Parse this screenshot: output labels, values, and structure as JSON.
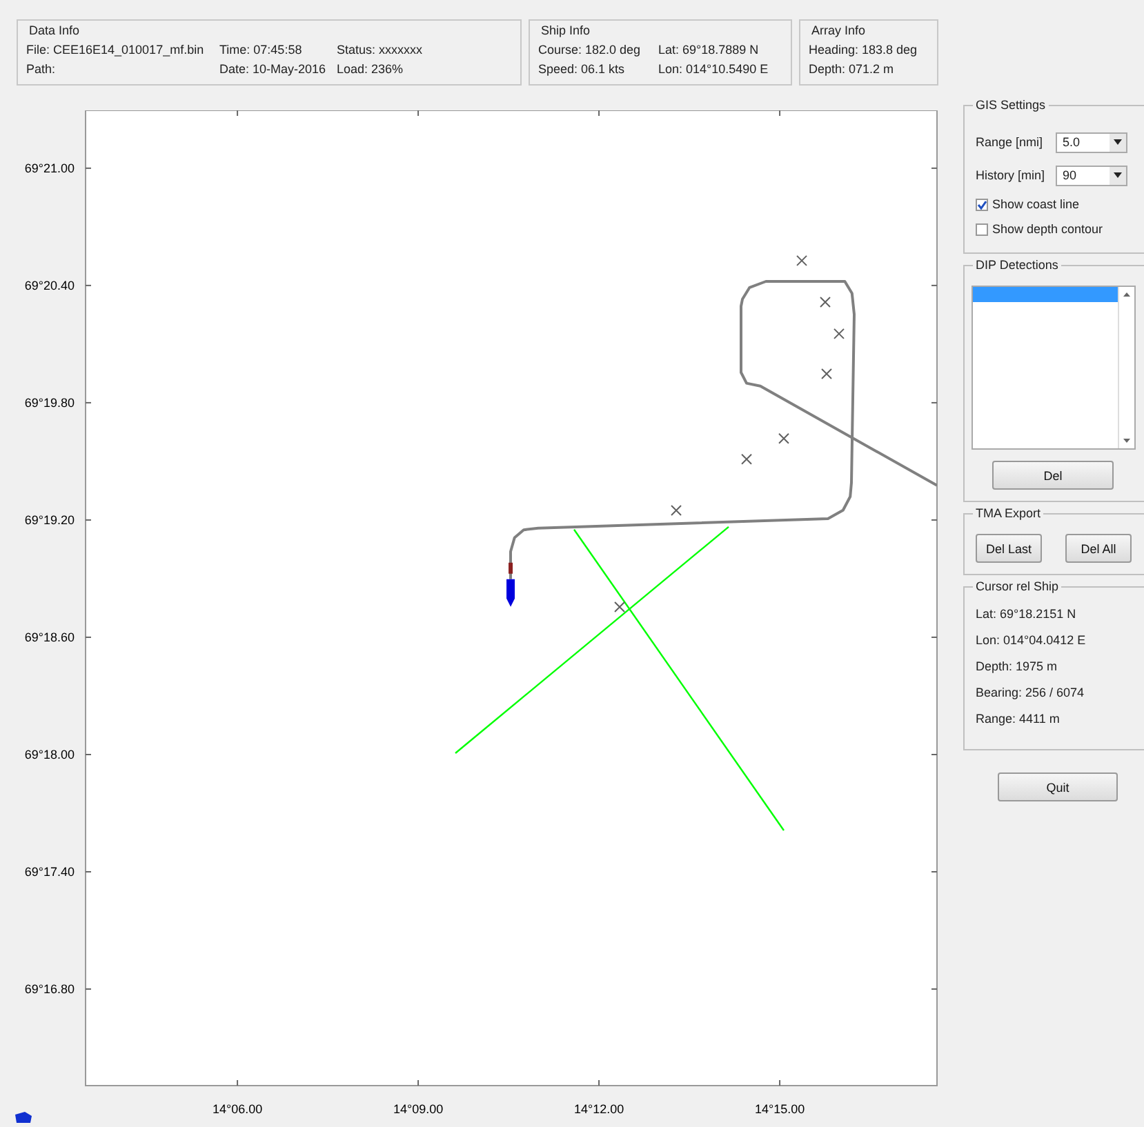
{
  "header": [
    {
      "title": "Data Info",
      "rows": [
        [
          "File: CEE16E14_010017_mf.bin",
          "Time: 07:45:58",
          "Status: xxxxxxx"
        ],
        [
          "Path:",
          "Date: 10-May-2016",
          "Load: 236%"
        ]
      ]
    },
    {
      "title": "Ship Info",
      "rows": [
        [
          "Course: 182.0 deg",
          "Lat: 69°18.7889 N"
        ],
        [
          "Speed: 06.1 kts",
          "Lon: 014°10.5490 E"
        ]
      ]
    },
    {
      "title": "Array Info",
      "rows": [
        [
          "Heading: 183.8 deg"
        ],
        [
          "Depth: 071.2 m"
        ]
      ]
    }
  ],
  "map": {
    "y_labels": [
      "69°21.00",
      "69°20.40",
      "69°19.80",
      "69°19.20",
      "69°18.60",
      "69°18.00",
      "69°17.40",
      "69°16.80"
    ],
    "x_labels": [
      "14°06.00",
      "14°09.00",
      "14°12.00",
      "14°15.00"
    ]
  },
  "gis_settings": {
    "title": "GIS Settings",
    "range_label": "Range [nmi]",
    "range_value": "5.0",
    "history_label": "History [min]",
    "history_value": "90",
    "checkboxes": [
      {
        "label": "Show coast line",
        "checked": true
      },
      {
        "label": "Show depth contour",
        "checked": false
      }
    ]
  },
  "dip_detections": {
    "title": "DIP Detections",
    "rows": [
      {
        "selected": true
      }
    ],
    "button": "Del"
  },
  "tma_export": {
    "title": "TMA Export",
    "buttons": [
      "Del Last",
      "Del All"
    ]
  },
  "cursor_rel_ship": {
    "title": "Cursor rel Ship",
    "lines": [
      "Lat: 69°18.2151 N",
      "Lon: 014°04.0412 E",
      "Depth: 1975 m",
      "Bearing: 256 / 6074",
      "Range: 4411 m"
    ]
  },
  "quit_button": "Quit"
}
